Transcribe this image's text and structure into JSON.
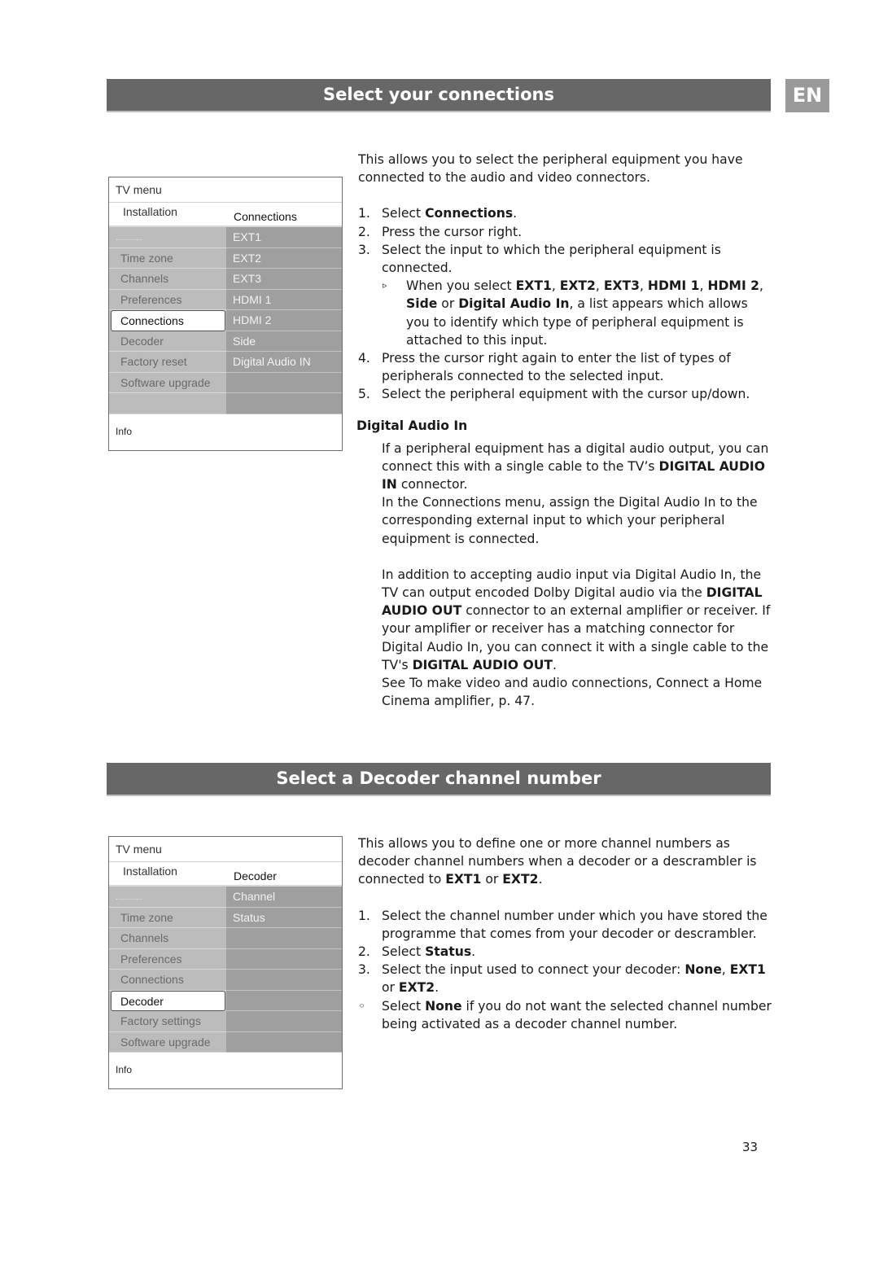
{
  "lang_badge": "EN",
  "page_number": "33",
  "section1": {
    "title": "Select your connections",
    "menu": {
      "title": "TV menu",
      "left_header": "Installation",
      "right_header": "Connections",
      "left_items": [
        {
          "label": "............",
          "state": "dots"
        },
        {
          "label": "Time zone",
          "state": "normal"
        },
        {
          "label": "Channels",
          "state": "normal"
        },
        {
          "label": "Preferences",
          "state": "normal"
        },
        {
          "label": "Connections",
          "state": "selected"
        },
        {
          "label": "Decoder",
          "state": "normal"
        },
        {
          "label": "Factory reset",
          "state": "normal"
        },
        {
          "label": "Software upgrade",
          "state": "normal"
        },
        {
          "label": "",
          "state": "normal"
        }
      ],
      "right_items": [
        "EXT1",
        "EXT2",
        "EXT3",
        "HDMI 1",
        "HDMI 2",
        "Side",
        "Digital Audio IN",
        "",
        ""
      ],
      "info": "Info"
    },
    "intro": "This allows you to select the peripheral equipment you have connected to the audio and video connectors.",
    "steps": {
      "s1_num": "1.",
      "s1_a": "Select ",
      "s1_b": "Connections",
      "s1_c": ".",
      "s2_num": "2.",
      "s2": "Press the cursor right.",
      "s3_num": "3.",
      "s3": "Select the input to which the peripheral equipment is connected.",
      "s3_sub_marker": "▹",
      "s3_sub_a": "When you select ",
      "s3_sub_ext1": "EXT1",
      "s3_sub_ext2": "EXT2",
      "s3_sub_ext3": "EXT3",
      "s3_sub_hdmi1": "HDMI 1",
      "s3_sub_hdmi2": "HDMI 2",
      "s3_sub_side": "Side",
      "s3_sub_or": " or ",
      "s3_sub_dai": "Digital Audio In",
      "s3_sub_comma": ", ",
      "s3_sub_b": ", a list appears which allows you to identify which type of peripheral equipment is attached to this input.",
      "s4_num": "4.",
      "s4": "Press the cursor right again to enter the list of types of peripherals connected to the selected input.",
      "s5_num": "5.",
      "s5": "Select the peripheral equipment with the cursor up/down."
    },
    "dai": {
      "heading": "Digital Audio In",
      "p1_a": "If a peripheral equipment has a digital audio output, you can connect this with a single cable to the TV’s ",
      "p1_b": "DIGITAL AUDIO IN",
      "p1_c": " connector.",
      "p2": "In the Connections menu, assign the Digital Audio In to the corresponding external input to which your peripheral equipment is connected.",
      "p3_a": "In addition to accepting audio input via Digital Audio In, the TV can output encoded Dolby Digital audio via the ",
      "p3_b": "DIGITAL AUDIO OUT",
      "p3_c": " connector to an external amplifier or receiver. If your amplifier or receiver has a matching connector for Digital Audio In, you can connect it with a single cable to the TV's ",
      "p3_d": "DIGITAL AUDIO OUT",
      "p3_e": ".",
      "p4": "See To make video and audio connections, Connect a Home Cinema amplifier, p. 47."
    }
  },
  "section2": {
    "title": "Select a Decoder channel number",
    "menu": {
      "title": "TV menu",
      "left_header": "Installation",
      "right_header": "Decoder",
      "left_items": [
        {
          "label": "............",
          "state": "dots"
        },
        {
          "label": "Time zone",
          "state": "normal"
        },
        {
          "label": "Channels",
          "state": "normal"
        },
        {
          "label": "Preferences",
          "state": "normal"
        },
        {
          "label": "Connections",
          "state": "normal"
        },
        {
          "label": "Decoder",
          "state": "selected"
        },
        {
          "label": "Factory settings",
          "state": "normal"
        },
        {
          "label": "Software upgrade",
          "state": "normal"
        }
      ],
      "right_items": [
        "Channel",
        "Status",
        "",
        "",
        "",
        "",
        "",
        ""
      ],
      "info": "Info"
    },
    "intro_a": "This allows you to define one or more channel numbers as decoder channel numbers when a decoder or a descrambler is connected to ",
    "intro_ext1": "EXT1",
    "intro_or": " or ",
    "intro_ext2": "EXT2",
    "intro_end": ".",
    "steps": {
      "s1_num": "1.",
      "s1": "Select the channel number under which you have stored the programme that comes from your decoder or descrambler.",
      "s2_num": "2.",
      "s2_a": "Select ",
      "s2_b": "Status",
      "s2_c": ".",
      "s3_num": "3.",
      "s3_a": "Select the input used to connect your decoder: ",
      "s3_none": "None",
      "s3_comma": ",",
      "s3_ext1": "EXT1",
      "s3_or": " or ",
      "s3_ext2": "EXT2",
      "s3_end": ".",
      "bullet_marker": "◦",
      "b_a": "Select ",
      "b_none": "None",
      "b_c": " if you do not want the selected channel number being activated as a decoder channel number."
    }
  }
}
